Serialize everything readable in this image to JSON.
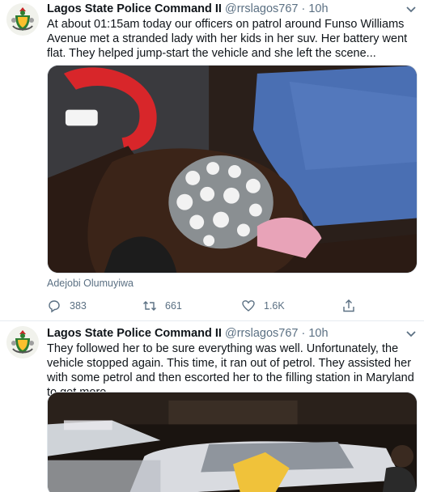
{
  "tweets": [
    {
      "author_name": "Lagos State Police Command II",
      "handle": "@rrslagos767",
      "separator": "·",
      "time": "10h",
      "text": "At about 01:15am today our officers on patrol around Funso Williams Avenue met a stranded lady with her kids in her suv. Her battery went flat. They helped jump-start the vehicle and she left the scene...",
      "media_credit": "Adejobi Olumuyiwa",
      "replies": "383",
      "retweets": "661",
      "likes": "1.6K"
    },
    {
      "author_name": "Lagos State Police Command II",
      "handle": "@rrslagos767",
      "separator": "·",
      "time": "10h",
      "text": "They followed her to be sure everything was well. Unfortunately, the vehicle stopped again. This time, it ran out of petrol. They assisted her with some petrol and then escorted her to the filling station in Maryland to get more..."
    }
  ],
  "icons": {
    "avatar": "police-crest-icon",
    "more": "chevron-down-icon",
    "reply": "reply-icon",
    "retweet": "retweet-icon",
    "like": "heart-icon",
    "share": "share-icon"
  },
  "colors": {
    "text": "#0f1419",
    "secondary": "#5b7083",
    "divider": "#e6ecf0"
  }
}
